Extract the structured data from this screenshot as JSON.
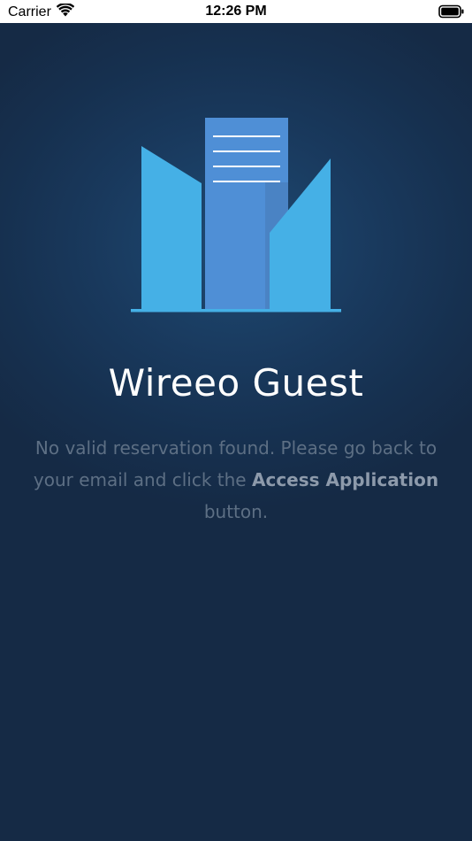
{
  "status_bar": {
    "carrier": "Carrier",
    "time": "12:26 PM",
    "icons": {
      "wifi": "wifi-icon",
      "battery": "battery-icon"
    }
  },
  "app": {
    "logo_icon": "building-logo-icon",
    "title": "Wireeo Guest"
  },
  "message": {
    "part1": "No valid reservation found. Please go back to your email and click the ",
    "highlight": "Access Application",
    "part2": " button."
  },
  "colors": {
    "background_top": "#1e4a73",
    "background_bottom": "#152a45",
    "logo_light_blue": "#45b0e6",
    "logo_mid_blue": "#4f8fd6",
    "message_text": "#5d6f84",
    "message_highlight": "#8d9aab"
  }
}
